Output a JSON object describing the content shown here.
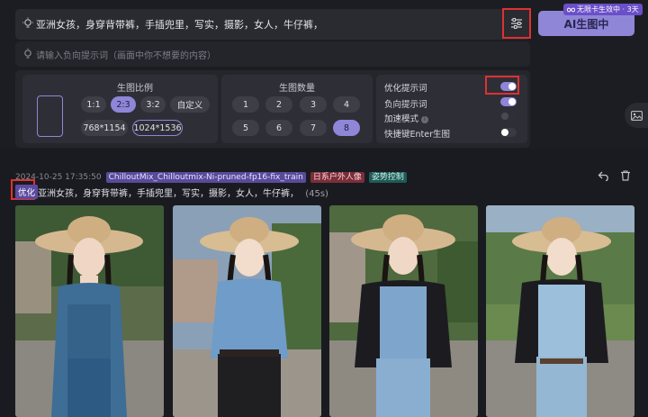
{
  "prompt": {
    "text": "亚洲女孩，身穿背带裤，手插兜里，写实，摄影，女人，牛仔裤，",
    "negative_placeholder": "请输入负向提示词（画面中你不想要的内容）"
  },
  "generate": {
    "button_label": "AI生图中",
    "badge_text": "无限卡生效中 · 3天"
  },
  "ratio": {
    "title": "生图比例",
    "options": [
      "1:1",
      "2:3",
      "3:2",
      "自定义"
    ],
    "selected": "2:3",
    "sizes": [
      "768*1154",
      "1024*1536"
    ],
    "selected_size": "1024*1536"
  },
  "count": {
    "title": "生图数量",
    "options": [
      "1",
      "2",
      "3",
      "4",
      "5",
      "6",
      "7",
      "8"
    ],
    "selected": "8"
  },
  "options": {
    "optimize_prompt": {
      "label": "优化提示词",
      "on": true
    },
    "negative_prompt": {
      "label": "负向提示词",
      "on": true
    },
    "accelerate": {
      "label": "加速模式",
      "on": false
    },
    "enter_shortcut": {
      "label": "快捷键Enter生图",
      "on": false
    }
  },
  "result": {
    "timestamp": "2024-10-25 17:35:50",
    "model_tag": "ChilloutMix_Chilloutmix-Ni-pruned-fp16-fix_train",
    "style_tag": "日系户外人像",
    "pose_tag": "姿势控制",
    "optimized_label": "优化",
    "prompt": "亚洲女孩，身穿背带裤，手插兜里，写实，摄影，女人，牛仔裤，",
    "duration": "(45s)"
  },
  "colors": {
    "accent": "#8f86d8",
    "highlight_box": "#e03030",
    "model_tag": "#5a4a9a",
    "style_tag": "#7a2e3a",
    "pose_tag": "#1f5a56"
  },
  "icons": [
    "lightbulb-icon",
    "settings-sliders-icon",
    "infinity-icon",
    "image-icon",
    "undo-icon",
    "trash-icon"
  ]
}
